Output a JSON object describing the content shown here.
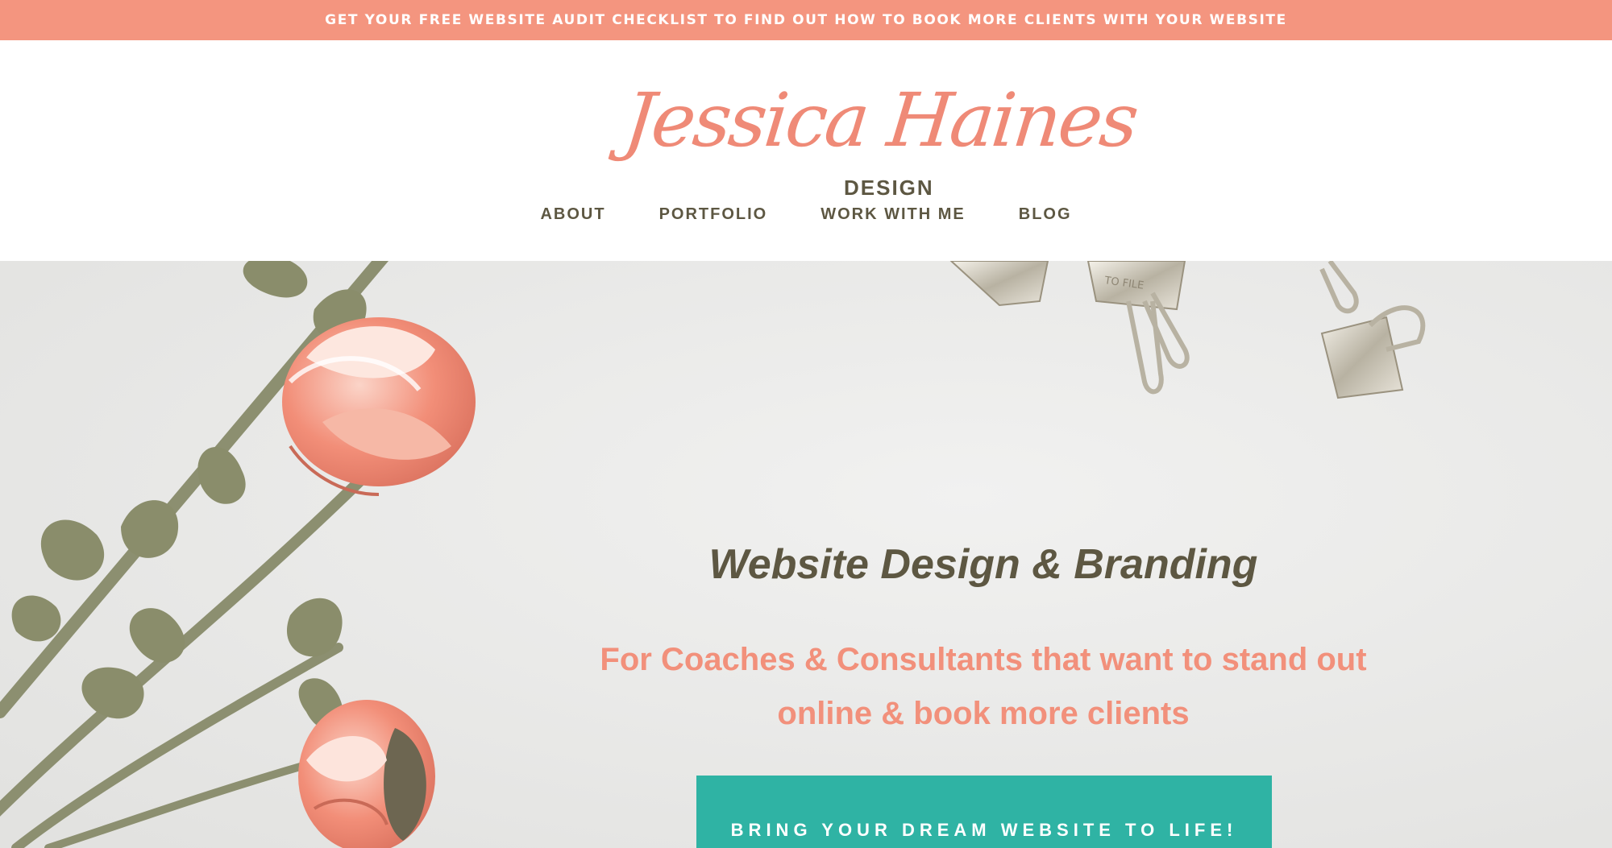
{
  "announcement": {
    "text": "GET YOUR FREE WEBSITE AUDIT CHECKLIST TO FIND OUT HOW TO BOOK MORE CLIENTS WITH YOUR WEBSITE"
  },
  "logo": {
    "script": "Jessica Haines",
    "sub": "DESIGN"
  },
  "nav": {
    "items": [
      "ABOUT",
      "PORTFOLIO",
      "WORK WITH ME",
      "BLOG"
    ]
  },
  "hero": {
    "heading": "Website Design & Branding",
    "subheading": "For Coaches & Consultants that want to stand out online & book more clients",
    "cta_label": "BRING YOUR DREAM WEBSITE TO LIFE!",
    "binder_clip_text": "TO FILE"
  },
  "colors": {
    "accent_coral": "#f4957f",
    "text_brown": "#5d5742",
    "teal": "#2fb3a4",
    "background_grey": "#ebebea"
  }
}
